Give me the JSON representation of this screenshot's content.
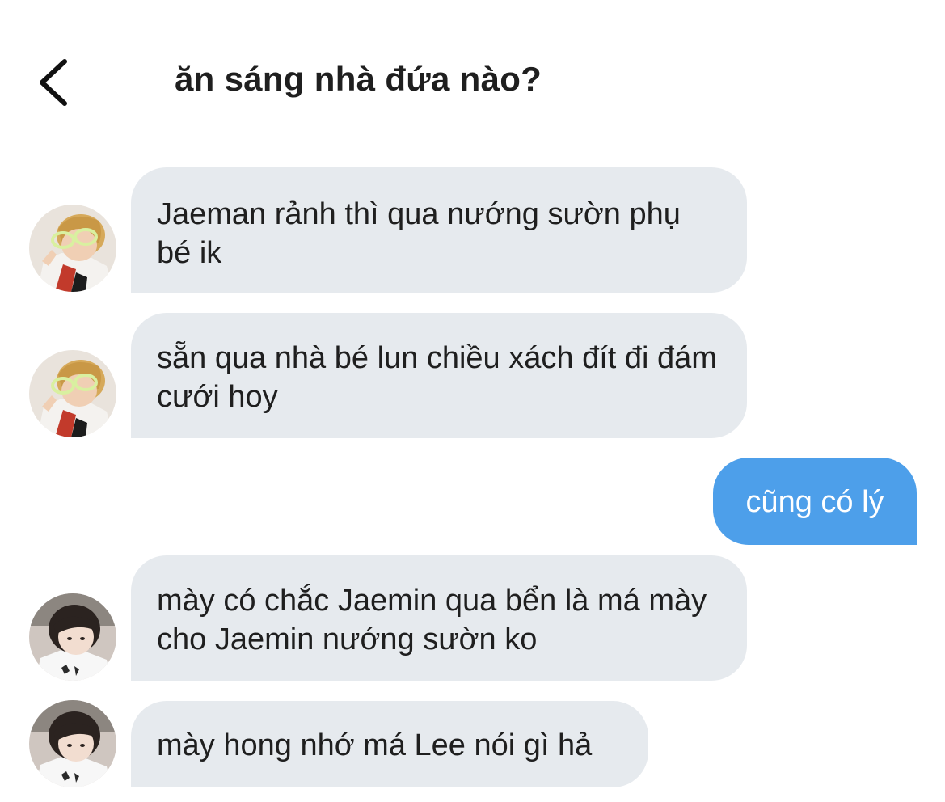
{
  "header": {
    "title": "ăn sáng nhà đứa nào?",
    "back_icon": "chevron-left-icon"
  },
  "messages": [
    {
      "id": 1,
      "direction": "incoming",
      "sender_avatar": "avatar-user-a",
      "text": "Jaeman rảnh thì qua nướng sườn phụ bé ik"
    },
    {
      "id": 2,
      "direction": "incoming",
      "sender_avatar": "avatar-user-a",
      "text": "sẵn qua nhà bé lun chiều xách đít đi đám cưới hoy"
    },
    {
      "id": 3,
      "direction": "outgoing",
      "text": "cũng có lý"
    },
    {
      "id": 4,
      "direction": "incoming",
      "sender_avatar": "avatar-user-b",
      "text": "mày có chắc Jaemin qua bển là má mày cho Jaemin nướng sườn ko"
    },
    {
      "id": 5,
      "direction": "incoming",
      "sender_avatar": "avatar-user-b",
      "text": "mày hong nhớ má Lee nói gì hả"
    }
  ],
  "colors": {
    "incoming_bubble": "#e6eaee",
    "outgoing_bubble": "#4d9fea",
    "outgoing_text": "#ffffff",
    "text": "#1f1f1f",
    "background": "#ffffff"
  }
}
